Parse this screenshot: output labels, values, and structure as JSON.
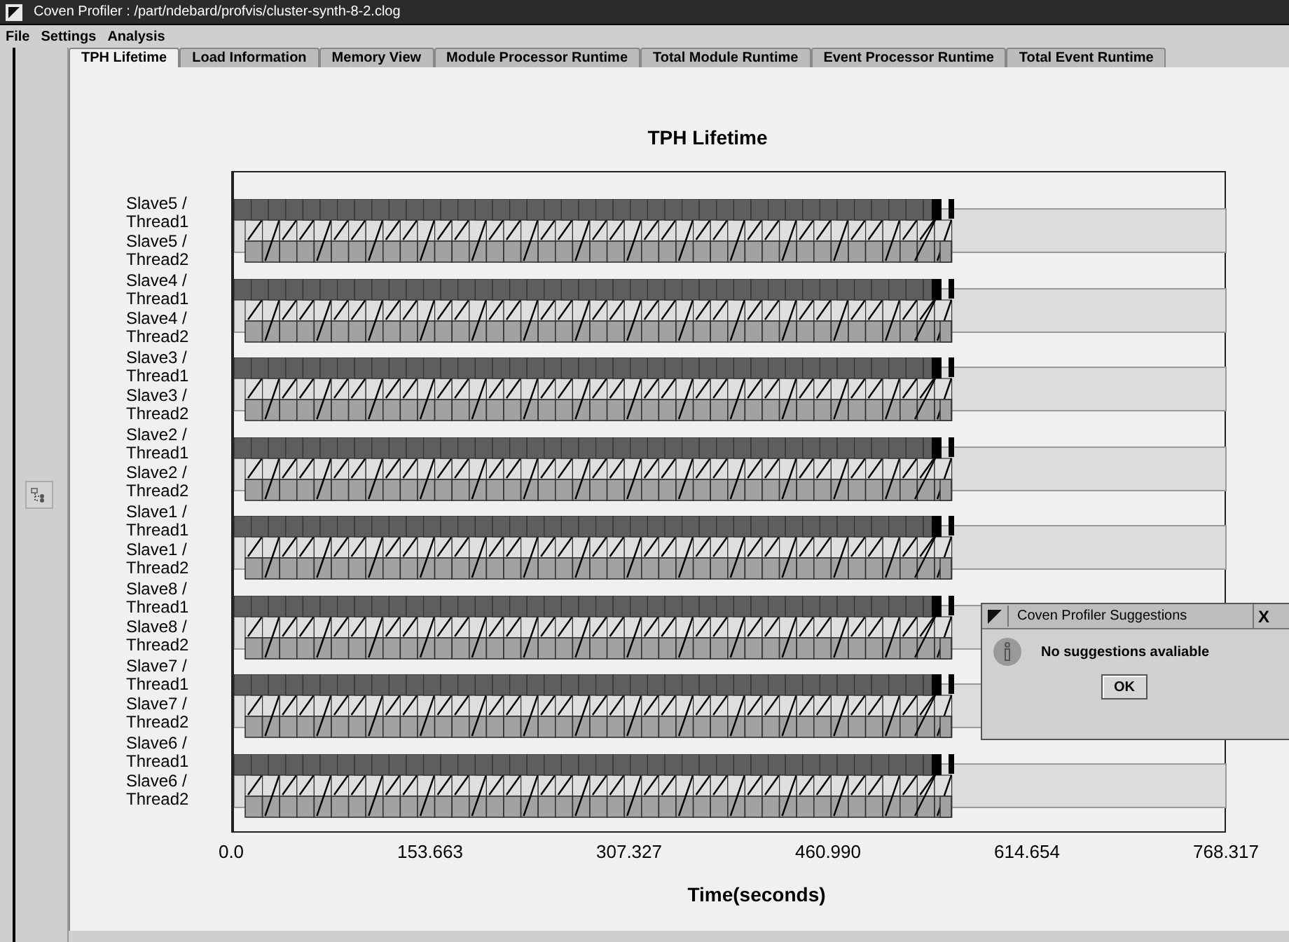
{
  "window": {
    "title": "Coven Profiler : /part/ndebard/profvis/cluster-synth-8-2.clog"
  },
  "menu": [
    "File",
    "Settings",
    "Analysis"
  ],
  "tabs": [
    {
      "label": "TPH Lifetime",
      "selected": true
    },
    {
      "label": "Load Information",
      "selected": false
    },
    {
      "label": "Memory View",
      "selected": false
    },
    {
      "label": "Module Processor Runtime",
      "selected": false
    },
    {
      "label": "Total Module Runtime",
      "selected": false
    },
    {
      "label": "Event Processor Runtime",
      "selected": false
    },
    {
      "label": "Total Event Runtime",
      "selected": false
    }
  ],
  "chart": {
    "title": "TPH Lifetime",
    "xlabel": "Time(seconds)",
    "y_labels": [
      "Slave5 / Thread1",
      "Slave5 / Thread2",
      "Slave4 / Thread1",
      "Slave4 / Thread2",
      "Slave3 / Thread1",
      "Slave3 / Thread2",
      "Slave2 / Thread1",
      "Slave2 / Thread2",
      "Slave1 / Thread1",
      "Slave1 / Thread2",
      "Slave8 / Thread1",
      "Slave8 / Thread2",
      "Slave7 / Thread1",
      "Slave7 / Thread2",
      "Slave6 / Thread1",
      "Slave6 / Thread2"
    ],
    "xticks": [
      "0.0",
      "153.663",
      "307.327",
      "460.990",
      "614.654",
      "768.317"
    ]
  },
  "dialog": {
    "title": "Coven Profiler Suggestions",
    "close": "X",
    "message": "No suggestions avaliable",
    "button": "OK"
  }
}
